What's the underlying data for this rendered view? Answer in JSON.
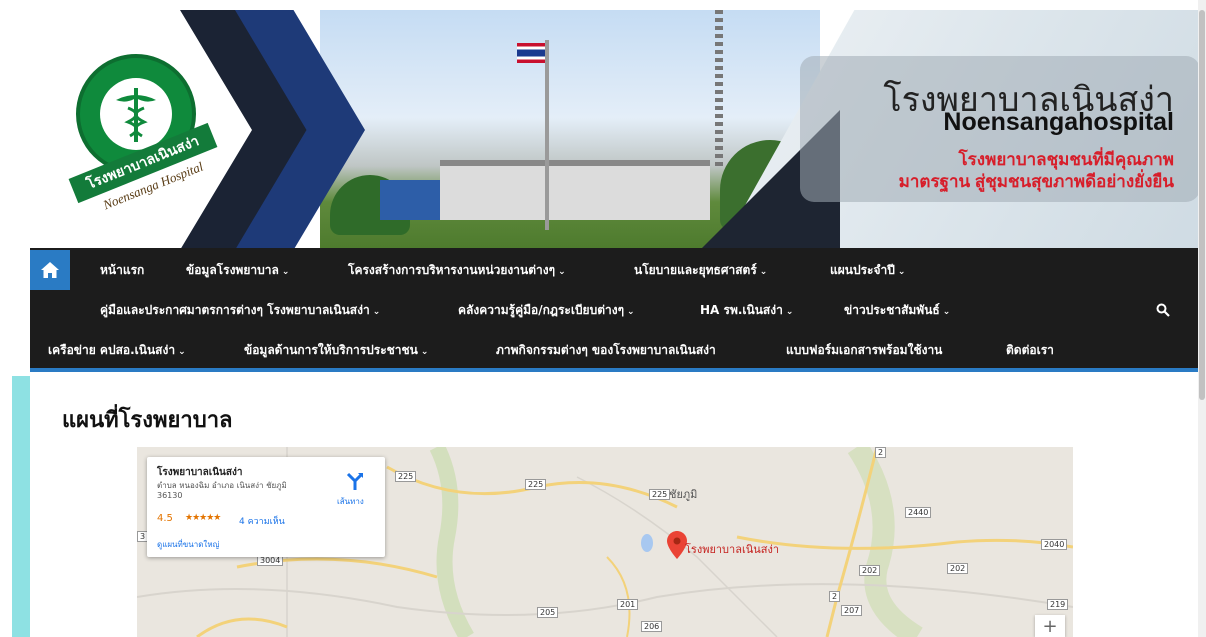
{
  "banner": {
    "hospital_name_th": "โรงพยาบาลเนินสง่า",
    "hospital_name_en": "Noensangahospital",
    "slogan_line1": "โรงพยาบาลชุมชนที่มีคุณภาพ",
    "slogan_line2": "มาตรฐาน สู่ชุมชนสุขภาพดีอย่างยั่งยืน",
    "seal_text": "โรงพยาบาลเนินสง่า",
    "seal_subtext": "Noensanga Hospital",
    "accent_color": "#d71e2a"
  },
  "nav": {
    "home_icon": "home-icon",
    "row1": [
      {
        "label": "หน้าแรก",
        "caret": false
      },
      {
        "label": "ข้อมูลโรงพยาบาล",
        "caret": true
      },
      {
        "label": "โครงสร้างการบริหารงานหน่วยงานต่างๆ",
        "caret": true
      },
      {
        "label": "นโยบายและยุทธศาสตร์",
        "caret": true
      },
      {
        "label": "แผนประจำปี",
        "caret": true
      }
    ],
    "row2": [
      {
        "label": "คู่มือและประกาศมาตรการต่างๆ โรงพยาบาลเนินสง่า",
        "caret": true
      },
      {
        "label": "คลังความรู้คู่มือ/กฎระเบียบต่างๆ",
        "caret": true
      },
      {
        "label": "HA รพ.เนินสง่า",
        "caret": true
      },
      {
        "label": "ข่าวประชาสัมพันธ์",
        "caret": true
      }
    ],
    "row3": [
      {
        "label": "เครือข่าย คปสอ.เนินสง่า",
        "caret": true
      },
      {
        "label": "ข้อมูลด้านการให้บริการประชาชน",
        "caret": true
      },
      {
        "label": "ภาพกิจกรรมต่างๆ ของโรงพยาบาลเนินสง่า",
        "caret": false
      },
      {
        "label": "แบบฟอร์มเอกสารพร้อมใช้งาน",
        "caret": false
      },
      {
        "label": "ติดต่อเรา",
        "caret": false
      }
    ],
    "caret_glyph": "⌄",
    "bg_color": "#1c1c1c",
    "active_color": "#2a7bc4"
  },
  "content": {
    "title": "แผนที่โรงพยาบาล"
  },
  "map": {
    "card": {
      "name": "โรงพยาบาลเนินสง่า",
      "address": "ตำบล หนองฉิม อำเภอ เนินสง่า ชัยภูมิ 36130",
      "rating": "4.5",
      "stars": "★★★★★",
      "reviews": "4 ความเห็น",
      "larger_map": "ดูแผนที่ขนาดใหญ่",
      "directions": "เส้นทาง"
    },
    "pin_label": "โรงพยาบาลเนินสง่า",
    "province_label": "ชัยภูมิ",
    "route_labels": [
      "225",
      "225",
      "225",
      "2",
      "2440",
      "2040",
      "202",
      "202",
      "2",
      "207",
      "201",
      "205",
      "206",
      "219",
      "3004",
      "3"
    ],
    "zoom_in": "+"
  }
}
